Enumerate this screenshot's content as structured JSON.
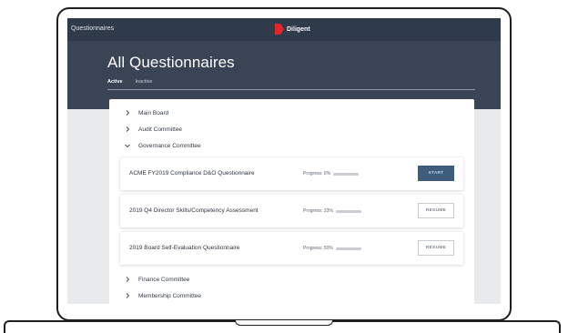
{
  "app": {
    "title": "Questionnaires",
    "brand": "Diligent",
    "brand_color": "#e4262c",
    "header_color": "#2f3a4a"
  },
  "page": {
    "title": "All Questionnaires",
    "tabs": [
      {
        "label": "Active",
        "active": true
      },
      {
        "label": "Inactive",
        "active": false
      }
    ]
  },
  "groups": [
    {
      "label": "Main Board",
      "expanded": false
    },
    {
      "label": "Audit Committee",
      "expanded": false
    },
    {
      "label": "Governance Committee",
      "expanded": true
    },
    {
      "label": "Finance Committee",
      "expanded": false
    },
    {
      "label": "Membership Committee",
      "expanded": false
    }
  ],
  "questionnaires": [
    {
      "title": "ACME FY2019 Compliance D&O Questionnaire",
      "progress_label": "Progress: 0%",
      "progress": 0,
      "action": "START"
    },
    {
      "title": "2019 Q4 Director Skills/Competency Assessment",
      "progress_label": "Progress: 33%",
      "progress": 33,
      "action": "RESUME"
    },
    {
      "title": "2019 Board Self-Evaluation Questionnaire",
      "progress_label": "Progress: 50%",
      "progress": 50,
      "action": "RESUME"
    }
  ],
  "icons": {
    "collapsed": "chevron-right-icon",
    "expanded": "chevron-down-icon"
  }
}
